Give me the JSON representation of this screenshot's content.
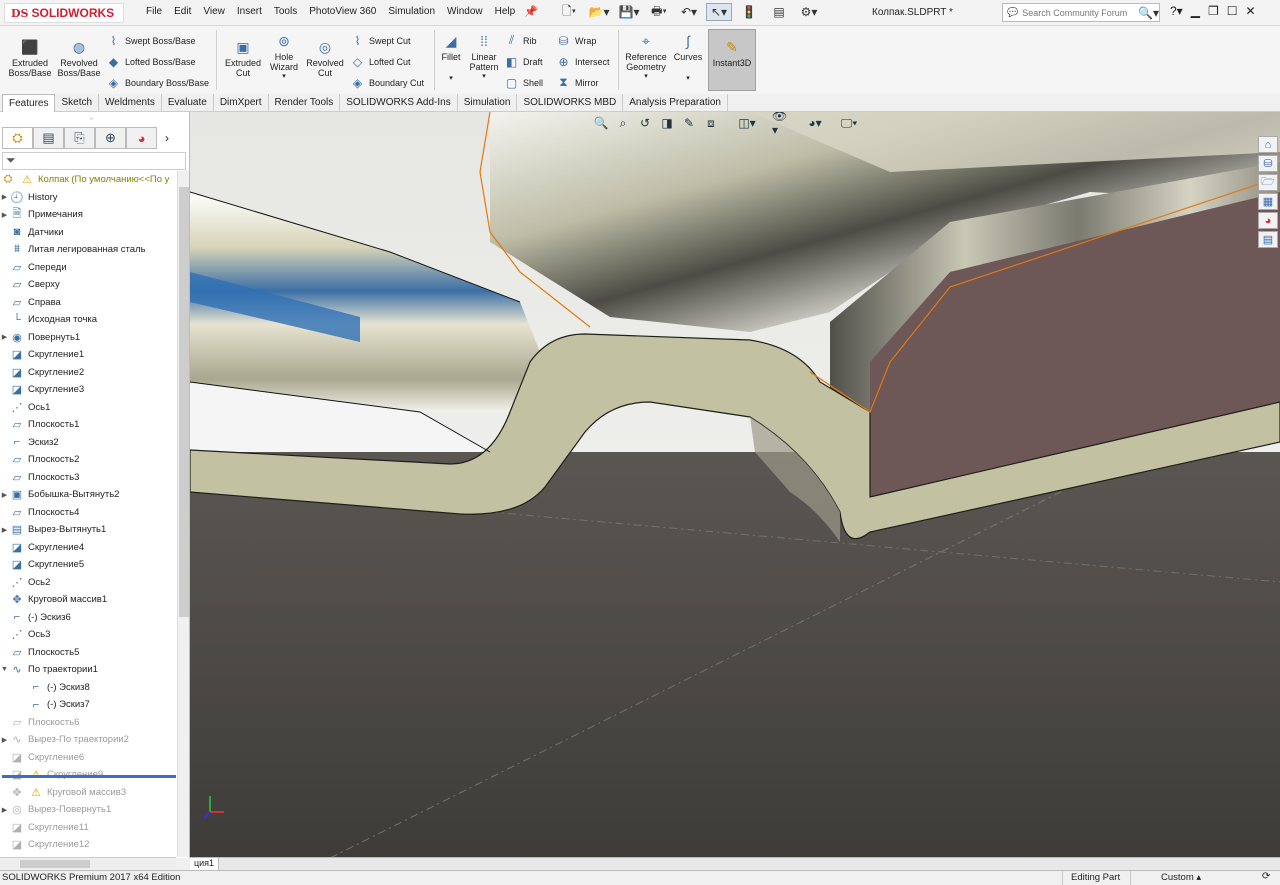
{
  "app": {
    "brand": "SOLIDWORKS",
    "doc_title": "Колпак.SLDPRT *",
    "search_placeholder": "Search Community Forum"
  },
  "menu": [
    "File",
    "Edit",
    "View",
    "Insert",
    "Tools",
    "PhotoView 360",
    "Simulation",
    "Window",
    "Help"
  ],
  "ribbon": {
    "extruded_boss": "Extruded Boss/Base",
    "revolved_boss": "Revolved Boss/Base",
    "swept_boss": "Swept Boss/Base",
    "lofted_boss": "Lofted Boss/Base",
    "boundary_boss": "Boundary Boss/Base",
    "extruded_cut": "Extruded Cut",
    "hole_wizard": "Hole Wizard",
    "revolved_cut": "Revolved Cut",
    "swept_cut": "Swept Cut",
    "lofted_cut": "Lofted Cut",
    "boundary_cut": "Boundary Cut",
    "fillet": "Fillet",
    "linear_pattern": "Linear Pattern",
    "rib": "Rib",
    "draft": "Draft",
    "shell": "Shell",
    "wrap": "Wrap",
    "intersect": "Intersect",
    "mirror": "Mirror",
    "reference_geometry": "Reference Geometry",
    "curves": "Curves",
    "instant3d": "Instant3D"
  },
  "tabs": [
    "Features",
    "Sketch",
    "Weldments",
    "Evaluate",
    "DimXpert",
    "Render Tools",
    "SOLIDWORKS Add-Ins",
    "Simulation",
    "SOLIDWORKS MBD",
    "Analysis Preparation"
  ],
  "tree": {
    "root": "Колпак  (По умолчанию<<По у",
    "items": [
      {
        "label": "History",
        "icon": "history-icon",
        "exp": "▶"
      },
      {
        "label": "Примечания",
        "icon": "annotations-icon",
        "exp": "▶"
      },
      {
        "label": "Датчики",
        "icon": "sensors-icon",
        "exp": ""
      },
      {
        "label": "Литая легированная сталь",
        "icon": "material-icon",
        "exp": ""
      },
      {
        "label": "Спереди",
        "icon": "plane-icon",
        "exp": ""
      },
      {
        "label": "Сверху",
        "icon": "plane-icon",
        "exp": ""
      },
      {
        "label": "Справа",
        "icon": "plane-icon",
        "exp": ""
      },
      {
        "label": "Исходная точка",
        "icon": "origin-icon",
        "exp": ""
      },
      {
        "label": "Повернуть1",
        "icon": "revolve-icon",
        "exp": "▶"
      },
      {
        "label": "Скругление1",
        "icon": "fillet-icon",
        "exp": ""
      },
      {
        "label": "Скругление2",
        "icon": "fillet-icon",
        "exp": ""
      },
      {
        "label": "Скругление3",
        "icon": "fillet-icon",
        "exp": ""
      },
      {
        "label": "Ось1",
        "icon": "axis-icon",
        "exp": ""
      },
      {
        "label": "Плоскость1",
        "icon": "plane-icon",
        "exp": ""
      },
      {
        "label": "Эскиз2",
        "icon": "sketch-icon",
        "exp": ""
      },
      {
        "label": "Плоскость2",
        "icon": "plane-icon",
        "exp": ""
      },
      {
        "label": "Плоскость3",
        "icon": "plane-icon",
        "exp": ""
      },
      {
        "label": "Бобышка-Вытянуть2",
        "icon": "boss-extrude-icon",
        "exp": "▶"
      },
      {
        "label": "Плоскость4",
        "icon": "plane-icon",
        "exp": ""
      },
      {
        "label": "Вырез-Вытянуть1",
        "icon": "cut-extrude-icon",
        "exp": "▶"
      },
      {
        "label": "Скругление4",
        "icon": "fillet-icon",
        "exp": ""
      },
      {
        "label": "Скругление5",
        "icon": "fillet-icon",
        "exp": ""
      },
      {
        "label": "Ось2",
        "icon": "axis-icon",
        "exp": ""
      },
      {
        "label": "Круговой массив1",
        "icon": "circular-pattern-icon",
        "exp": ""
      },
      {
        "label": "(-) Эскиз6",
        "icon": "sketch-icon",
        "exp": ""
      },
      {
        "label": "Ось3",
        "icon": "axis-icon",
        "exp": ""
      },
      {
        "label": "Плоскость5",
        "icon": "plane-icon",
        "exp": ""
      },
      {
        "label": "По траектории1",
        "icon": "sweep-icon",
        "exp": "▼"
      },
      {
        "label": "(-) Эскиз8",
        "icon": "sketch-icon",
        "exp": "",
        "indent": true
      },
      {
        "label": "(-) Эскиз7",
        "icon": "sketch-icon",
        "exp": "",
        "indent": true
      },
      {
        "label": "Плоскость6",
        "icon": "plane-icon",
        "exp": "",
        "dim": true
      },
      {
        "label": "Вырез-По траектории2",
        "icon": "sweep-cut-icon",
        "exp": "▶",
        "dim": true
      },
      {
        "label": "Скругление6",
        "icon": "fillet-icon",
        "exp": "",
        "dim": true
      },
      {
        "label": "Скругление9",
        "icon": "fillet-icon",
        "exp": "",
        "dim": true,
        "warn": true
      },
      {
        "label": "Круговой массив3",
        "icon": "circular-pattern-icon",
        "exp": "",
        "dim": true,
        "warn": true
      },
      {
        "label": "Вырез-Повернуть1",
        "icon": "cut-revolve-icon",
        "exp": "▶",
        "dim": true
      },
      {
        "label": "Скругление11",
        "icon": "fillet-icon",
        "exp": "",
        "dim": true
      },
      {
        "label": "Скругление12",
        "icon": "fillet-icon",
        "exp": "",
        "dim": true
      }
    ]
  },
  "bottom_tab": "ция1",
  "status": {
    "left": "SOLIDWORKS Premium 2017 x64 Edition",
    "mode": "Editing Part",
    "units": "Custom"
  },
  "colors": {
    "accent": "#d01f2e",
    "model_section": "#c0c0a0",
    "pink_face": "#6e5757",
    "edge": "#e07a10"
  }
}
